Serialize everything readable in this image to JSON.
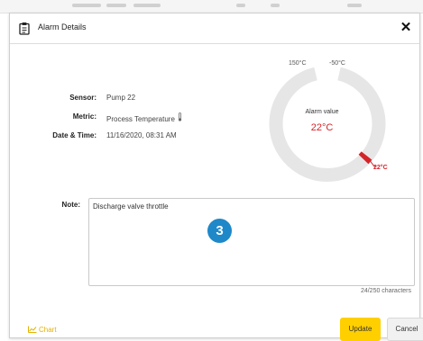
{
  "dialog": {
    "title": "Alarm Details",
    "close_symbol": "✕",
    "title_icon": "clipboard-icon"
  },
  "fields": {
    "sensor": {
      "label": "Sensor:",
      "value": "Pump 22"
    },
    "metric": {
      "label": "Metric:",
      "value": "Process Temperature",
      "icon": "thermometer-icon"
    },
    "datetime": {
      "label": "Date & Time:",
      "value": "11/16/2020, 08:31 AM"
    }
  },
  "gauge": {
    "left_label": "150°C",
    "right_label": "-50°C",
    "title": "Alarm value",
    "value_text": "22°C",
    "marker_label": "22°C",
    "colors": {
      "track": "#e6e6e6",
      "value": "#d3242a"
    }
  },
  "note": {
    "label": "Note:",
    "text": "Discharge valve throttle",
    "char_count": "24/250 characters",
    "step_badge": "3"
  },
  "footer": {
    "chart_link": "Chart",
    "update_label": "Update",
    "cancel_label": "Cancel"
  },
  "colors": {
    "accent_yellow": "#ffcf00",
    "badge_blue": "#1e88c9",
    "alarm_red": "#d3242a"
  }
}
